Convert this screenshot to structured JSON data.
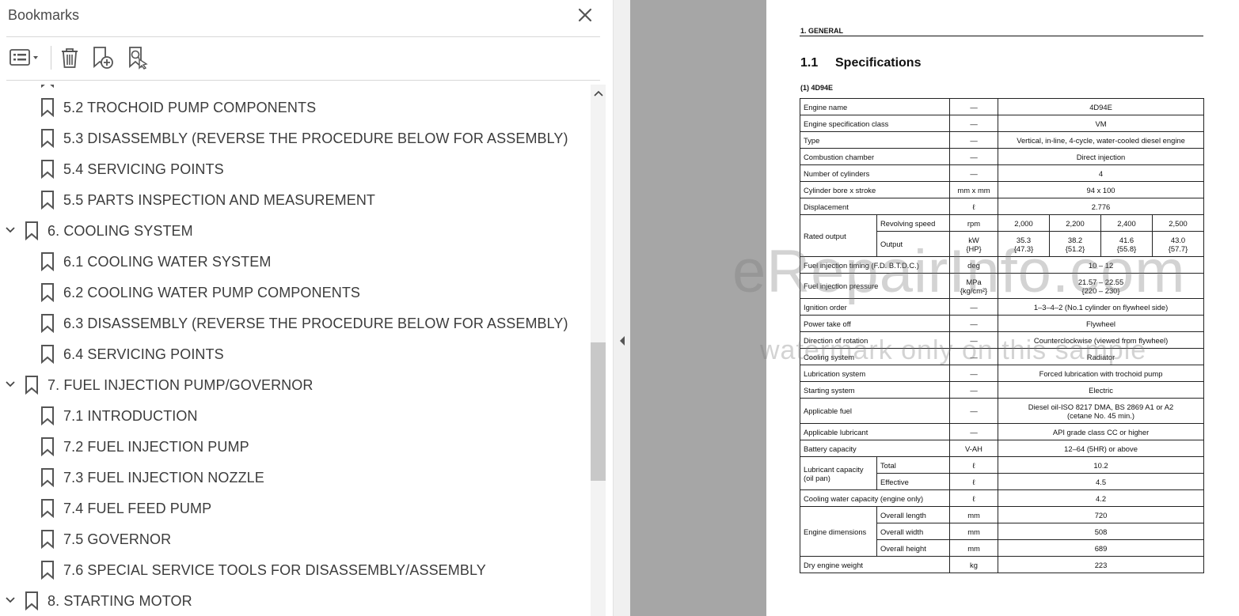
{
  "bookmarks_panel": {
    "title": "Bookmarks",
    "toolbar": {
      "options_icon": "list-options-icon",
      "delete_icon": "trash-icon",
      "add_icon": "new-bookmark-icon",
      "find_icon": "find-current-bookmark-icon"
    },
    "items": [
      {
        "label": "5.2 TROCHOID PUMP COMPONENTS",
        "level": 2
      },
      {
        "label": "5.3 DISASSEMBLY (REVERSE THE PROCEDURE BELOW FOR ASSEMBLY)",
        "level": 2
      },
      {
        "label": "5.4 SERVICING POINTS",
        "level": 2
      },
      {
        "label": "5.5 PARTS INSPECTION AND MEASUREMENT",
        "level": 2
      },
      {
        "label": "6. COOLING SYSTEM",
        "level": 1,
        "expanded": true
      },
      {
        "label": "6.1 COOLING WATER SYSTEM",
        "level": 2
      },
      {
        "label": "6.2 COOLING WATER PUMP COMPONENTS",
        "level": 2
      },
      {
        "label": "6.3 DISASSEMBLY (REVERSE THE PROCEDURE BELOW FOR ASSEMBLY)",
        "level": 2
      },
      {
        "label": "6.4 SERVICING POINTS",
        "level": 2
      },
      {
        "label": "7. FUEL INJECTION PUMP/GOVERNOR",
        "level": 1,
        "expanded": true
      },
      {
        "label": "7.1 INTRODUCTION",
        "level": 2
      },
      {
        "label": "7.2 FUEL INJECTION PUMP",
        "level": 2
      },
      {
        "label": "7.3 FUEL INJECTION NOZZLE",
        "level": 2
      },
      {
        "label": "7.4 FUEL FEED PUMP",
        "level": 2
      },
      {
        "label": "7.5 GOVERNOR",
        "level": 2
      },
      {
        "label": "7.6 SPECIAL SERVICE TOOLS FOR DISASSEMBLY/ASSEMBLY",
        "level": 2
      },
      {
        "label": "8. STARTING MOTOR",
        "level": 1,
        "expanded": true
      }
    ]
  },
  "document": {
    "section_header": "1. GENERAL",
    "heading_number": "1.1",
    "heading_title": "Specifications",
    "model_label": "(1)  4D94E",
    "watermark_main": "eRepairInfo.com",
    "watermark_sub": "watermark only on this sample",
    "rows": {
      "engine_name": {
        "label": "Engine name",
        "unit": "—",
        "value": "4D94E"
      },
      "spec_class": {
        "label": "Engine specification class",
        "unit": "—",
        "value": "VM"
      },
      "type": {
        "label": "Type",
        "unit": "—",
        "value": "Vertical, in-line, 4-cycle, water-cooled diesel engine"
      },
      "combustion": {
        "label": "Combustion chamber",
        "unit": "—",
        "value": "Direct injection"
      },
      "cylinders": {
        "label": "Number of cylinders",
        "unit": "—",
        "value": "4"
      },
      "bore": {
        "label": "Cylinder bore x stroke",
        "unit": "mm x mm",
        "value": "94 x 100"
      },
      "displacement": {
        "label": "Displacement",
        "unit": "ℓ",
        "value": "2.776"
      },
      "rated_output": {
        "label": "Rated output",
        "speed_label": "Revolving speed",
        "speed_unit": "rpm",
        "speeds": [
          "2,000",
          "2,200",
          "2,400",
          "2,500"
        ],
        "output_label": "Output",
        "output_unit_1": "kW",
        "output_unit_2": "{HP}",
        "outputs_kw": [
          "35.3",
          "38.2",
          "41.6",
          "43.0"
        ],
        "outputs_hp": [
          "{47.3}",
          "{51.2}",
          "{55.8}",
          "{57.7}"
        ]
      },
      "inj_timing": {
        "label": "Fuel injection timing (F.D. B.T.D.C.)",
        "unit": "deg",
        "value": "10 – 12"
      },
      "inj_pressure": {
        "label": "Fuel injection pressure",
        "unit_1": "MPa",
        "unit_2": "{kg/cm²}",
        "value_1": "21.57 – 22.55",
        "value_2": "{220 – 230}"
      },
      "ignition": {
        "label": "Ignition order",
        "unit": "—",
        "value": "1–3–4–2 (No.1 cylinder on flywheel side)"
      },
      "pto": {
        "label": "Power take off",
        "unit": "—",
        "value": "Flywheel"
      },
      "rotation": {
        "label": "Direction of rotation",
        "unit": "—",
        "value": "Counterclockwise (viewed from flywheel)"
      },
      "cooling": {
        "label": "Cooling system",
        "unit": "—",
        "value": "Radiator"
      },
      "lubrication": {
        "label": "Lubrication system",
        "unit": "—",
        "value": "Forced lubrication with trochoid pump"
      },
      "starting": {
        "label": "Starting system",
        "unit": "—",
        "value": "Electric"
      },
      "fuel": {
        "label": "Applicable fuel",
        "unit": "—",
        "value_1": "Diesel oil-ISO 8217 DMA, BS 2869 A1 or A2",
        "value_2": "(cetane No. 45 min.)"
      },
      "lubricant": {
        "label": "Applicable lubricant",
        "unit": "—",
        "value": "API grade class CC or higher"
      },
      "battery": {
        "label": "Battery capacity",
        "unit": "V-AH",
        "value": "12–64 (5HR) or above"
      },
      "lube_capacity": {
        "label_1": "Lubricant capacity",
        "label_2": "(oil pan)",
        "total_label": "Total",
        "total_unit": "ℓ",
        "total_value": "10.2",
        "effective_label": "Effective",
        "effective_unit": "ℓ",
        "effective_value": "4.5"
      },
      "coolant": {
        "label": "Cooling water capacity (engine only)",
        "unit": "ℓ",
        "value": "4.2"
      },
      "dimensions": {
        "label": "Engine dimensions",
        "length_label": "Overall length",
        "length_unit": "mm",
        "length_value": "720",
        "width_label": "Overall width",
        "width_unit": "mm",
        "width_value": "508",
        "height_label": "Overall height",
        "height_unit": "mm",
        "height_value": "689"
      },
      "weight": {
        "label": "Dry engine weight",
        "unit": "kg",
        "value": "223"
      }
    }
  }
}
